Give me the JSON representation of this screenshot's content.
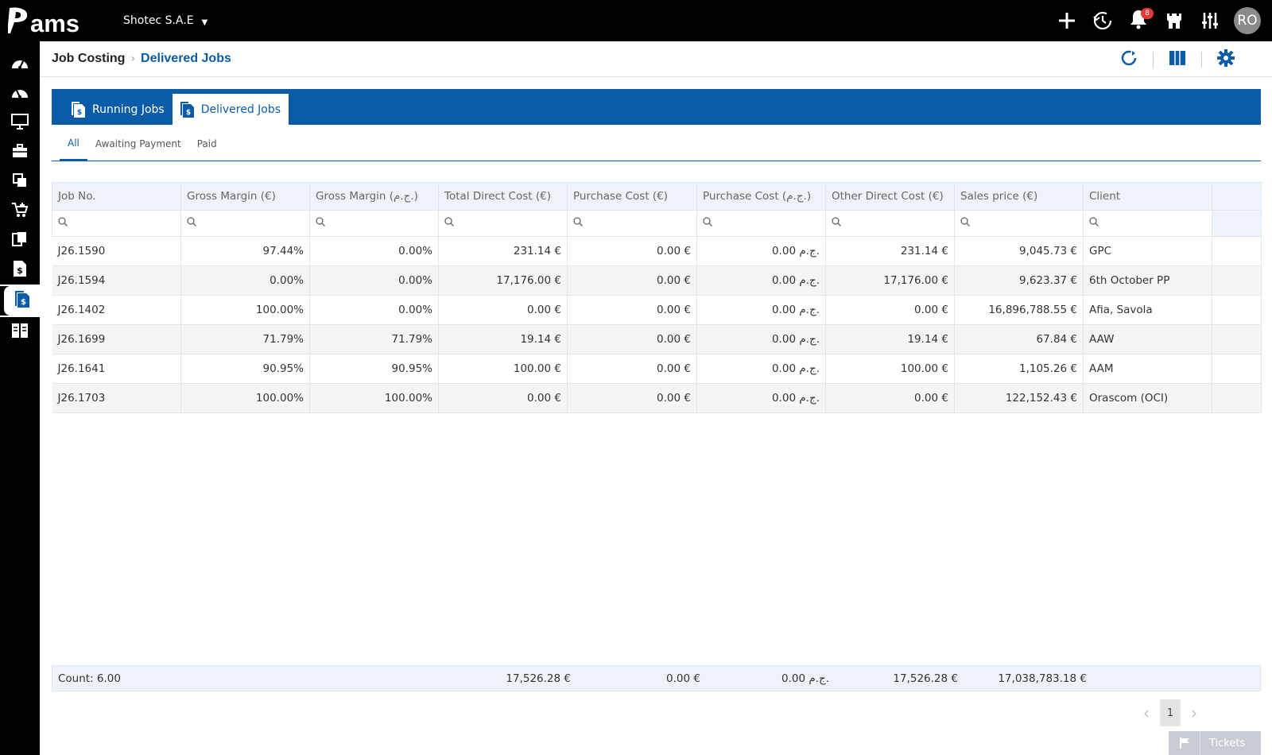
{
  "app": {
    "logo_text": "Pams"
  },
  "topbar": {
    "company": "Shotec S.A.E",
    "notifications_count": "8",
    "avatar_initials": "RO",
    "icons": [
      "plus-icon",
      "history-icon",
      "bell-icon",
      "castle-icon",
      "sliders-icon"
    ]
  },
  "sidebar": {
    "items": [
      "dashboard-icon",
      "dashboard-icon-2",
      "monitor-icon",
      "briefcase-icon",
      "documents-icon",
      "cart-icon",
      "files-icon",
      "invoice-dollar-icon",
      "job-costing-icon",
      "layout-icon"
    ],
    "active_index": 8
  },
  "breadcrumb": {
    "root": "Job Costing",
    "current": "Delivered Jobs"
  },
  "tabs": [
    {
      "label": "Running Jobs",
      "active": false
    },
    {
      "label": "Delivered Jobs",
      "active": true
    }
  ],
  "subtabs": [
    {
      "label": "All",
      "active": true
    },
    {
      "label": "Awaiting Payment",
      "active": false
    },
    {
      "label": "Paid",
      "active": false
    }
  ],
  "table": {
    "columns": [
      "Job No.",
      "Gross Margin (€)",
      "Gross Margin (ج.م.)",
      "Total Direct Cost (€)",
      "Purchase Cost (€)",
      "Purchase Cost (ج.م.)",
      "Other Direct Cost (€)",
      "Sales price (€)",
      "Client"
    ],
    "rows": [
      [
        "J26.1590",
        "97.44%",
        "0.00%",
        "231.14 €",
        "0.00 €",
        "0.00 ج.م.",
        "231.14 €",
        "9,045.73 €",
        "GPC"
      ],
      [
        "J26.1594",
        "0.00%",
        "0.00%",
        "17,176.00 €",
        "0.00 €",
        "0.00 ج.م.",
        "17,176.00 €",
        "9,623.37 €",
        "6th October PP"
      ],
      [
        "J26.1402",
        "100.00%",
        "0.00%",
        "0.00 €",
        "0.00 €",
        "0.00 ج.م.",
        "0.00 €",
        "16,896,788.55 €",
        "Afia, Savola"
      ],
      [
        "J26.1699",
        "71.79%",
        "71.79%",
        "19.14 €",
        "0.00 €",
        "0.00 ج.م.",
        "19.14 €",
        "67.84 €",
        "AAW"
      ],
      [
        "J26.1641",
        "90.95%",
        "90.95%",
        "100.00 €",
        "0.00 €",
        "0.00 ج.م.",
        "100.00 €",
        "1,105.26 €",
        "AAM"
      ],
      [
        "J26.1703",
        "100.00%",
        "100.00%",
        "0.00 €",
        "0.00 €",
        "0.00 ج.م.",
        "0.00 €",
        "122,152.43 €",
        "Orascom (OCI)"
      ]
    ]
  },
  "summary": {
    "count": "Count: 6.00",
    "total_direct_cost": "17,526.28 €",
    "purchase_cost_eur": "0.00 €",
    "purchase_cost_egp": "0.00 ج.م.",
    "other_direct_cost": "17,526.28 €",
    "sales_price": "17,038,783.18 €"
  },
  "pager": {
    "current_page": "1"
  },
  "tickets": {
    "label": "Tickets"
  },
  "colors": {
    "primary": "#0a5ca8",
    "topbar": "#000000",
    "badge": "#e53935",
    "header_bg": "#eef2f9"
  }
}
